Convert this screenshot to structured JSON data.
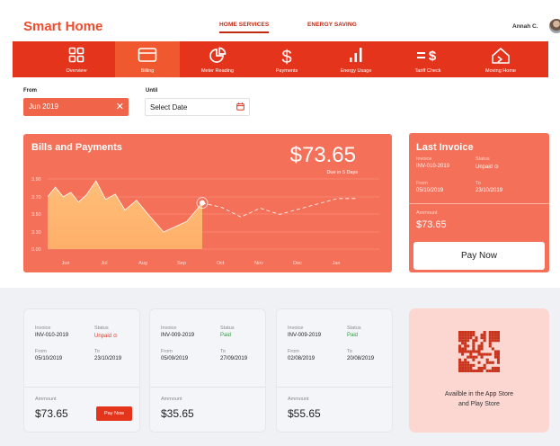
{
  "app": {
    "logo": "Smart Home"
  },
  "top_links": [
    "HOME SERVICES",
    "ENERGY SAVING"
  ],
  "user": {
    "name": "Annah C."
  },
  "nav": [
    {
      "label": "Overview",
      "icon": "grid-icon"
    },
    {
      "label": "Billing",
      "icon": "card-icon"
    },
    {
      "label": "Meter Reading",
      "icon": "pie-chart-icon"
    },
    {
      "label": "Payments",
      "icon": "dollar-icon"
    },
    {
      "label": "Energy Usage",
      "icon": "signal-bars-icon"
    },
    {
      "label": "Tariff Check",
      "icon": "tariff-icon"
    },
    {
      "label": "Moving Home",
      "icon": "house-icon"
    }
  ],
  "filters": {
    "from_label": "From",
    "from_value": "Jun 2019",
    "until_label": "Until",
    "until_placeholder": "Select Date"
  },
  "bills": {
    "title": "Bills and Payments",
    "amount": "$73.65",
    "due": "Due in 5 Days"
  },
  "chart_data": {
    "type": "line",
    "categories": [
      "Jun",
      "Jul",
      "Aug",
      "Sep",
      "Oct",
      "Nov",
      "Dec",
      "Jan"
    ],
    "y_ticks": [
      "3.90",
      "3.70",
      "3.50",
      "3.30",
      "0.00"
    ],
    "actual": [
      {
        "x": 0.0,
        "y": 3.7
      },
      {
        "x": 0.2,
        "y": 3.81
      },
      {
        "x": 0.4,
        "y": 3.7
      },
      {
        "x": 0.6,
        "y": 3.75
      },
      {
        "x": 0.8,
        "y": 3.64
      },
      {
        "x": 1.0,
        "y": 3.72
      },
      {
        "x": 1.25,
        "y": 3.88
      },
      {
        "x": 1.5,
        "y": 3.67
      },
      {
        "x": 1.75,
        "y": 3.73
      },
      {
        "x": 2.0,
        "y": 3.55
      },
      {
        "x": 2.3,
        "y": 3.66
      },
      {
        "x": 2.6,
        "y": 3.5
      },
      {
        "x": 3.0,
        "y": 3.3
      },
      {
        "x": 3.3,
        "y": 3.36
      },
      {
        "x": 3.6,
        "y": 3.42
      },
      {
        "x": 4.0,
        "y": 3.63
      }
    ],
    "forecast": [
      {
        "x": 4.0,
        "y": 3.63
      },
      {
        "x": 4.5,
        "y": 3.58
      },
      {
        "x": 5.0,
        "y": 3.47
      },
      {
        "x": 5.5,
        "y": 3.57
      },
      {
        "x": 6.0,
        "y": 3.5
      },
      {
        "x": 6.5,
        "y": 3.56
      },
      {
        "x": 7.0,
        "y": 3.62
      },
      {
        "x": 7.5,
        "y": 3.68
      },
      {
        "x": 8.0,
        "y": 3.68
      }
    ],
    "highlight_x": 4.0,
    "colors": {
      "area": "#ffb76b",
      "line": "#ffffff"
    }
  },
  "last_invoice": {
    "title": "Last Invoice",
    "invoice_label": "Invoice",
    "invoice": "INV-010-2019",
    "status_label": "Status",
    "status": "Unpaid",
    "from_label": "From",
    "from": "05/10/2019",
    "to_label": "To",
    "to": "23/10/2019",
    "amount_label": "Ammount",
    "amount": "$73.65",
    "pay_label": "Pay Now"
  },
  "tickets": [
    {
      "invoice_label": "Invoice",
      "invoice": "INV-010-2019",
      "status_label": "Status",
      "status": "Unpaid",
      "from_label": "From",
      "from": "05/10/2019",
      "to_label": "To",
      "to": "23/10/2019",
      "amount_label": "Ammount",
      "amount": "$73.65",
      "pay_label": "Pay Now"
    },
    {
      "invoice_label": "Invoice",
      "invoice": "INV-009-2019",
      "status_label": "Status",
      "status": "Paid",
      "from_label": "From",
      "from": "05/09/2019",
      "to_label": "To",
      "to": "27/09/2019",
      "amount_label": "Ammount",
      "amount": "$35.65"
    },
    {
      "invoice_label": "Invoice",
      "invoice": "INV-009-2019",
      "status_label": "Status",
      "status": "Paid",
      "from_label": "From",
      "from": "02/08/2019",
      "to_label": "To",
      "to": "20/08/2019",
      "amount_label": "Ammount",
      "amount": "$55.65"
    }
  ],
  "store": {
    "line1": "Availble in the App Store",
    "line2": "and Play Store"
  },
  "colors": {
    "brand": "#e4341c",
    "accent": "#f47058",
    "paid": "#2a9d3a"
  }
}
